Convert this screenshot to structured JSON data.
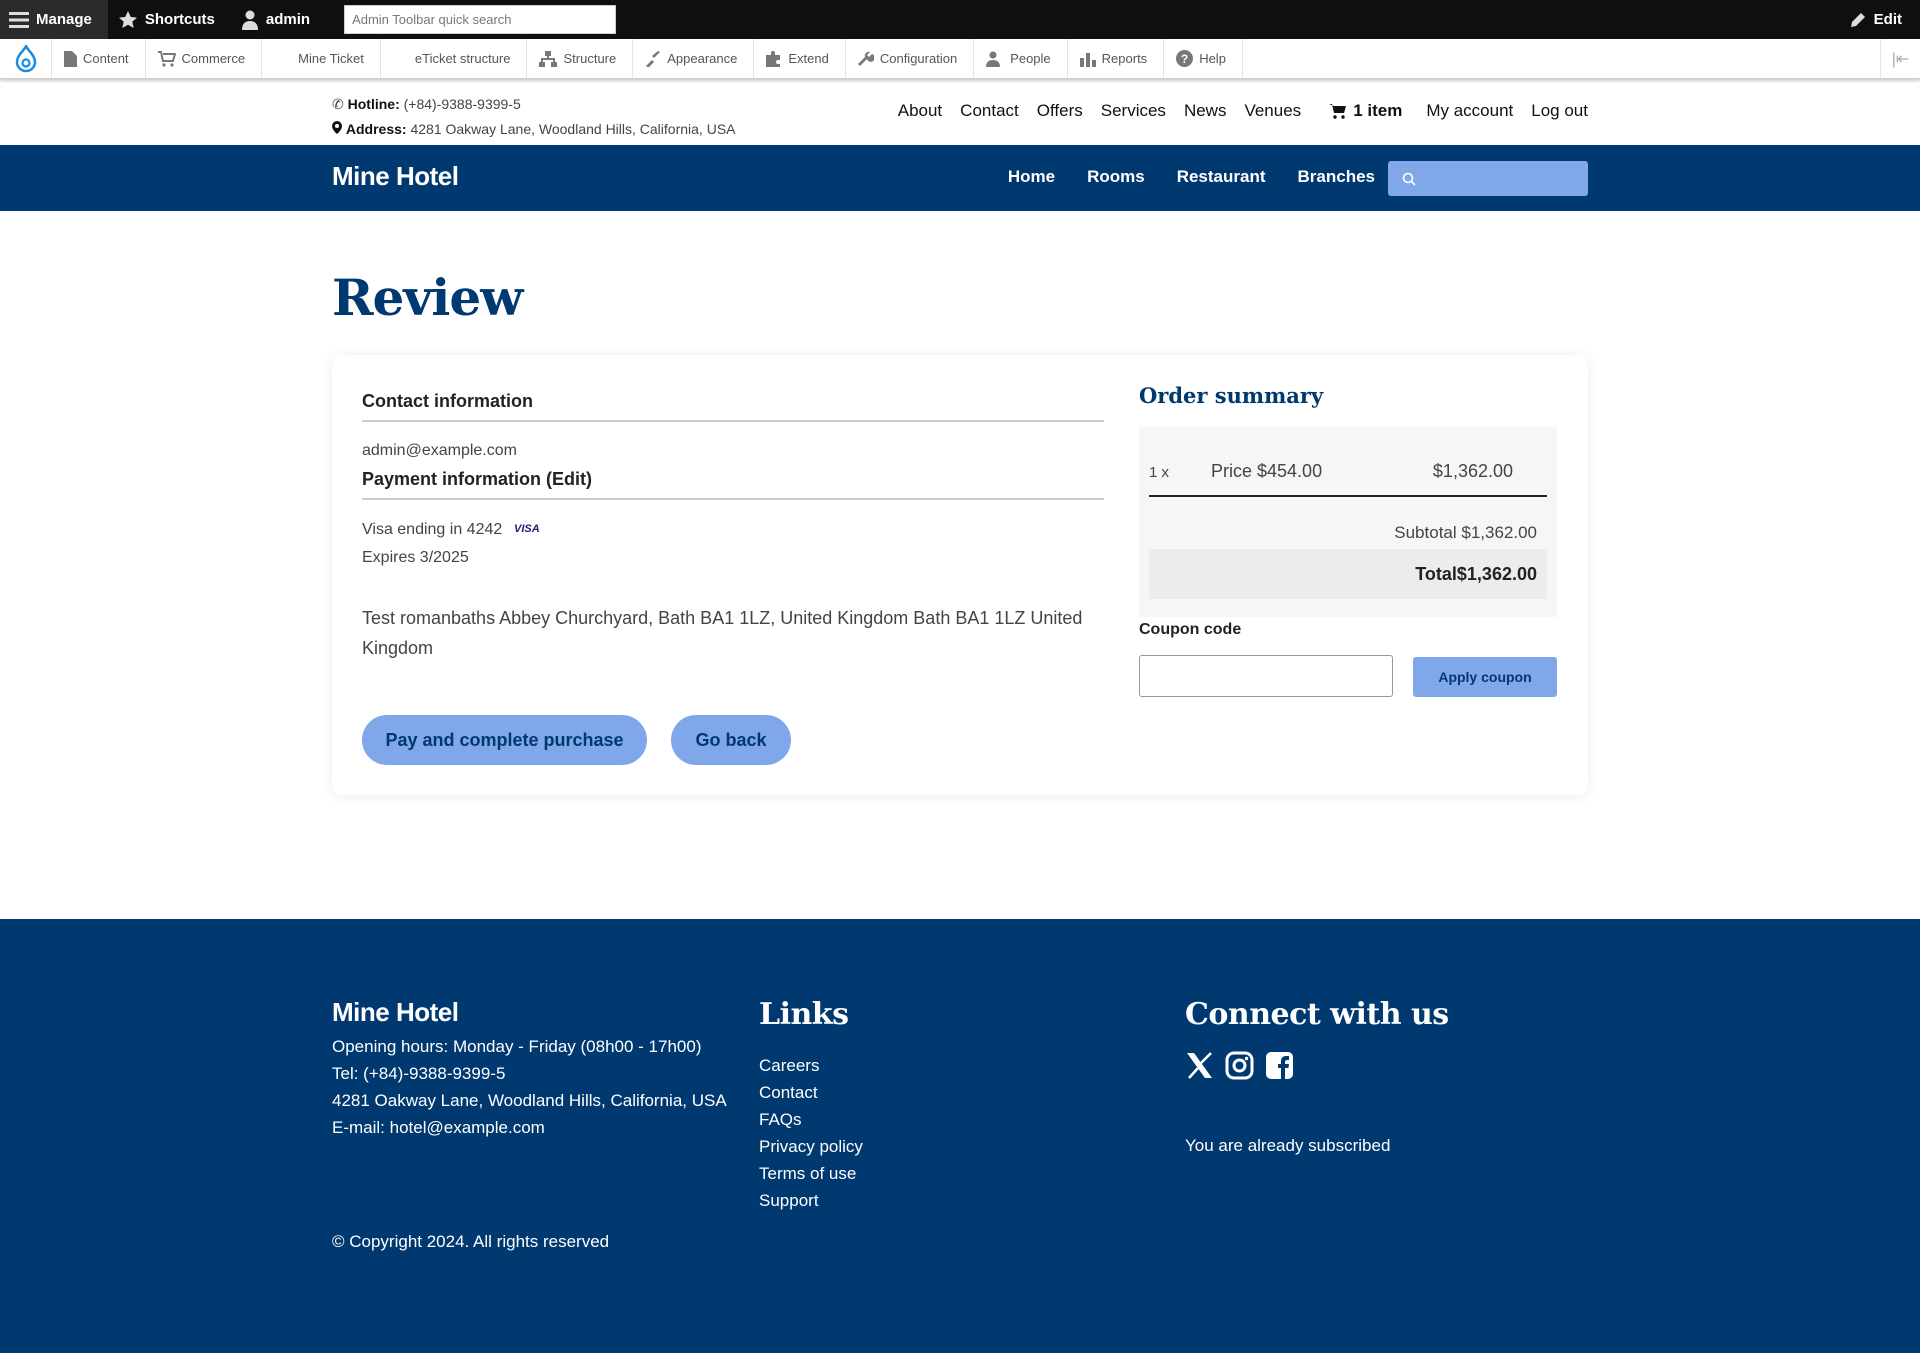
{
  "admin_toolbar": {
    "manage": "Manage",
    "shortcuts": "Shortcuts",
    "user": "admin",
    "search_placeholder": "Admin Toolbar quick search",
    "edit": "Edit"
  },
  "tray": {
    "items": [
      "Content",
      "Commerce",
      "Mine Ticket",
      "eTicket structure",
      "Structure",
      "Appearance",
      "Extend",
      "Configuration",
      "People",
      "Reports",
      "Help"
    ]
  },
  "topbar": {
    "hotline_label": "Hotline:",
    "hotline": "(+84)-9388-9399-5",
    "address_label": "Address:",
    "address": "4281 Oakway Lane, Woodland Hills, California, USA",
    "nav": [
      "About",
      "Contact",
      "Offers",
      "Services",
      "News",
      "Venues"
    ],
    "cart": "1 item",
    "account": "My account",
    "logout": "Log out"
  },
  "navbar": {
    "brand": "Mine Hotel",
    "items": [
      "Home",
      "Rooms",
      "Restaurant",
      "Branches"
    ]
  },
  "page": {
    "title": "Review",
    "contact_heading": "Contact information",
    "email": "admin@example.com",
    "payment_heading": "Payment information (Edit)",
    "card_text": "Visa ending in 4242",
    "card_brand": "VISA",
    "expires": "Expires 3/2025",
    "address_line1": "Test romanbaths Abbey Churchyard, Bath BA1 1LZ, United Kingdom Bath BA1 1LZ United",
    "address_line2": "Kingdom",
    "pay_button": "Pay and complete purchase",
    "back_button": "Go back"
  },
  "summary": {
    "heading": "Order summary",
    "qty": "1 x",
    "item": "Price $454.00",
    "line_total": "$1,362.00",
    "subtotal": "Subtotal $1,362.00",
    "total": "Total$1,362.00",
    "coupon_label": "Coupon code",
    "coupon_button": "Apply coupon"
  },
  "footer": {
    "brand": "Mine Hotel",
    "info": [
      "Opening hours: Monday - Friday (08h00 - 17h00)",
      "Tel: (+84)-9388-9399-5",
      "4281 Oakway Lane, Woodland Hills, California, USA",
      "E-mail: hotel@example.com"
    ],
    "links_heading": "Links",
    "links": [
      "Careers",
      "Contact",
      "FAQs",
      "Privacy policy",
      "Terms of use",
      "Support"
    ],
    "connect_heading": "Connect with us",
    "subscribed": "You are already subscribed",
    "copyright": "© Copyright 2024. All rights reserved"
  },
  "colors": {
    "brand_navy": "#003870",
    "button_blue": "#7fa7ea"
  }
}
